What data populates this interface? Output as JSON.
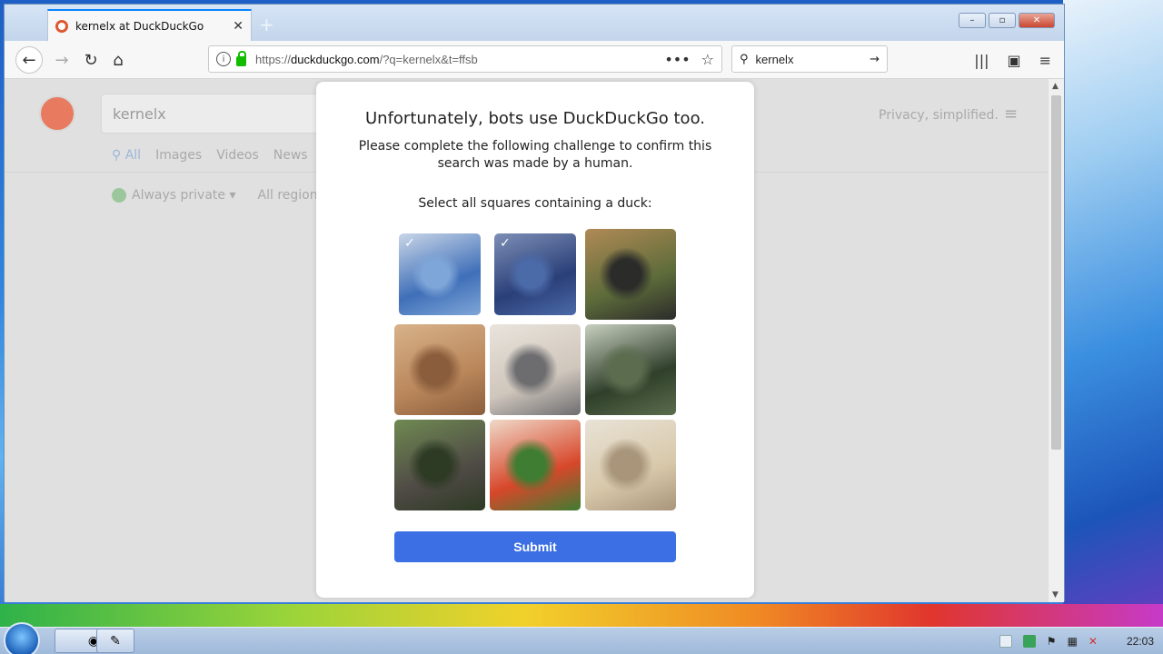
{
  "browser": {
    "tab_title": "kernelx at DuckDuckGo",
    "tab_close": "✕",
    "new_tab": "+",
    "url_host": "duckduckgo.com",
    "url_prefix": "https://",
    "url_rest": "/?q=kernelx&t=ffsb",
    "search_value": "kernelx"
  },
  "ddg": {
    "query": "kernelx",
    "tabs": [
      "All",
      "Images",
      "Videos",
      "News"
    ],
    "filters": [
      "Always private ▾",
      "All regions"
    ],
    "tagline": "Privacy, simplified."
  },
  "challenge": {
    "title": "Unfortunately, bots use DuckDuckGo too.",
    "subtitle": "Please complete the following challenge to confirm this search was made by a human.",
    "instruction": "Select all squares containing a duck:",
    "submit_label": "Submit",
    "tiles": [
      {
        "subject": "duck",
        "selected": true,
        "colors": [
          "#3f6fb8",
          "#7fa6d8",
          "#c9d6e8"
        ]
      },
      {
        "subject": "duck",
        "selected": true,
        "colors": [
          "#2a3f78",
          "#4b6aa8",
          "#7d8fb6"
        ]
      },
      {
        "subject": "bear",
        "selected": false,
        "colors": [
          "#5c6b3a",
          "#2b2b2a",
          "#b08a55"
        ]
      },
      {
        "subject": "otter",
        "selected": false,
        "colors": [
          "#b9865a",
          "#8a5d3c",
          "#d8b28a"
        ]
      },
      {
        "subject": "cats",
        "selected": false,
        "colors": [
          "#cfc6bc",
          "#6d6d70",
          "#e9e4dc"
        ]
      },
      {
        "subject": "ducks",
        "selected": false,
        "colors": [
          "#2f3f2a",
          "#5b6d4e",
          "#c9d0c0"
        ]
      },
      {
        "subject": "monkey",
        "selected": false,
        "colors": [
          "#4f4a45",
          "#2d3a24",
          "#6f8a52"
        ]
      },
      {
        "subject": "flower",
        "selected": false,
        "colors": [
          "#d7472a",
          "#3f7d32",
          "#f0d8c8"
        ]
      },
      {
        "subject": "rhino",
        "selected": false,
        "colors": [
          "#d8c8aa",
          "#a8957a",
          "#e8e2d6"
        ]
      }
    ]
  },
  "taskbar": {
    "clock": "22:03"
  },
  "colors": {
    "accent": "#3b6fe3",
    "tab_border": "#0a84ff"
  }
}
